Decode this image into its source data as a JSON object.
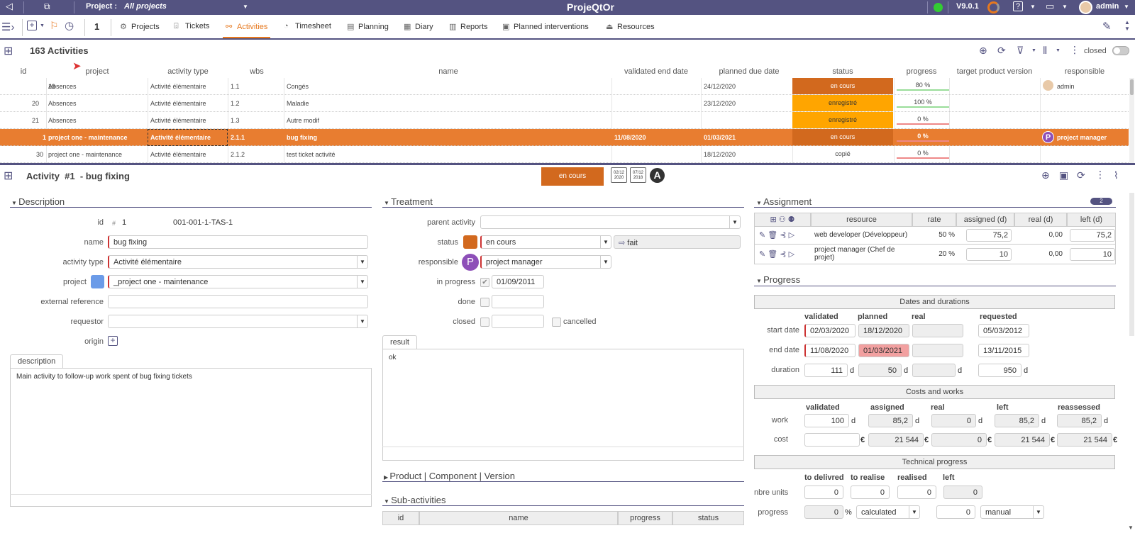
{
  "topbar": {
    "project_label": "Project :",
    "project_value": "All projects",
    "app_title": "ProjeQtOr",
    "version": "V9.0.1",
    "user": "admin"
  },
  "menu": {
    "count": "1",
    "items": [
      {
        "label": "Projects",
        "icon": "gear-icon"
      },
      {
        "label": "Tickets",
        "icon": "ticket-icon"
      },
      {
        "label": "Activities",
        "icon": "activity-icon"
      },
      {
        "label": "Timesheet",
        "icon": "stopwatch-icon"
      },
      {
        "label": "Planning",
        "icon": "planning-icon"
      },
      {
        "label": "Diary",
        "icon": "calendar-icon"
      },
      {
        "label": "Reports",
        "icon": "reports-icon"
      },
      {
        "label": "Planned interventions",
        "icon": "interventions-icon"
      },
      {
        "label": "Resources",
        "icon": "resources-icon"
      }
    ]
  },
  "list": {
    "title": "163 Activities",
    "closed_label": "closed",
    "columns": [
      "id",
      "project",
      "activity type",
      "wbs",
      "name",
      "validated end date",
      "planned due date",
      "status",
      "progress",
      "target product version",
      "responsible"
    ],
    "rows": [
      {
        "id": "19",
        "project": "Absences",
        "type": "Activité élémentaire",
        "wbs": "1.1",
        "name": "Congés",
        "validated_end": "",
        "planned_due": "24/12/2020",
        "status": "en cours",
        "status_color": "#d2691e",
        "progress": "80 %",
        "responsible": "admin"
      },
      {
        "id": "20",
        "project": "Absences",
        "type": "Activité élémentaire",
        "wbs": "1.2",
        "name": "Maladie",
        "validated_end": "",
        "planned_due": "23/12/2020",
        "status": "enregistré",
        "status_color": "#ffa500",
        "progress": "100 %",
        "responsible": ""
      },
      {
        "id": "21",
        "project": "Absences",
        "type": "Activité élémentaire",
        "wbs": "1.3",
        "name": "Autre modif",
        "validated_end": "",
        "planned_due": "",
        "status": "enregistré",
        "status_color": "#ffa500",
        "progress": "0 %",
        "responsible": ""
      },
      {
        "id": "1",
        "project": "project one - maintenance",
        "type": "Activité élémentaire",
        "wbs": "2.1.1",
        "name": "bug fixing",
        "validated_end": "11/08/2020",
        "planned_due": "01/03/2021",
        "status": "en cours",
        "status_color": "#d2691e",
        "progress": "0 %",
        "responsible": "project manager"
      },
      {
        "id": "30",
        "project": "project one - maintenance",
        "type": "Activité élémentaire",
        "wbs": "2.1.2",
        "name": "test ticket activité",
        "validated_end": "",
        "planned_due": "18/12/2020",
        "status": "copié",
        "status_color": "#ffffff",
        "progress": "0 %",
        "responsible": ""
      }
    ]
  },
  "detail": {
    "title": "Activity  #1  - bug fixing",
    "status_badge": "en cours",
    "date_icon_1": "02/12 2020",
    "date_icon_2": "07/12 2018",
    "avatar_letter": "A",
    "description": {
      "section": "Description",
      "id_label": "id",
      "id_hash": "#",
      "id_value": "1",
      "reference": "001-001-1-TAS-1",
      "name_label": "name",
      "name_value": "bug fixing",
      "type_label": "activity type",
      "type_value": "Activité élémentaire",
      "project_label": "project",
      "project_value": "_project one - maintenance",
      "ext_ref_label": "external reference",
      "requestor_label": "requestor",
      "origin_label": "origin",
      "desc_tab": "description",
      "desc_text": "Main activity to follow-up work spent of bug fixing tickets"
    },
    "treatment": {
      "section": "Treatment",
      "parent_label": "parent activity",
      "status_label": "status",
      "status_value": "en cours",
      "status_next": "fait",
      "responsible_label": "responsible",
      "responsible_value": "project manager",
      "responsible_letter": "P",
      "in_progress_label": "in progress",
      "in_progress_date": "01/09/2011",
      "done_label": "done",
      "closed_label": "closed",
      "cancelled_label": "cancelled",
      "result_tab": "result",
      "result_text": "ok",
      "product_section": "Product | Component | Version",
      "sub_section": "Sub-activities",
      "sub_columns": [
        "id",
        "name",
        "progress",
        "status"
      ]
    },
    "assignment": {
      "section": "Assignment",
      "count": "2",
      "columns": [
        "resource",
        "rate",
        "assigned (d)",
        "real (d)",
        "left (d)"
      ],
      "rows": [
        {
          "resource": "web developer (Développeur)",
          "rate": "50 %",
          "assigned": "75,2",
          "real": "0,00",
          "left": "75,2"
        },
        {
          "resource": "project manager (Chef de projet)",
          "rate": "20 %",
          "assigned": "10",
          "real": "0,00",
          "left": "10"
        }
      ]
    },
    "progress": {
      "section": "Progress",
      "dates_header": "Dates and durations",
      "date_cols": [
        "validated",
        "planned",
        "real",
        "requested"
      ],
      "start_label": "start date",
      "start": [
        "02/03/2020",
        "18/12/2020",
        "",
        "05/03/2012"
      ],
      "end_label": "end date",
      "end": [
        "11/08/2020",
        "01/03/2021",
        "",
        "13/11/2015"
      ],
      "duration_label": "duration",
      "duration": [
        "111",
        "50",
        "",
        "950"
      ],
      "d": "d",
      "costs_header": "Costs and works",
      "cost_cols": [
        "validated",
        "assigned",
        "real",
        "left",
        "reassessed"
      ],
      "work_label": "work",
      "work": [
        "100",
        "85,2",
        "0",
        "85,2",
        "85,2"
      ],
      "cost_label": "cost",
      "cost": [
        "",
        "21 544",
        "0",
        "21 544",
        "21 544"
      ],
      "euro": "€",
      "tech_header": "Technical progress",
      "tech_cols": [
        "to delivred",
        "to realise",
        "realised",
        "left"
      ],
      "units_label": "nbre units",
      "units": [
        "0",
        "0",
        "0",
        "0"
      ],
      "progress_label": "progress",
      "progress_value": "0",
      "pct": "%",
      "calc_mode": "calculated",
      "manual_value": "0",
      "manual_mode": "manual"
    }
  },
  "colors": {
    "brand": "#545381",
    "accent": "#e87d30",
    "in_progress": "#d2691e",
    "registered": "#ffa500"
  }
}
